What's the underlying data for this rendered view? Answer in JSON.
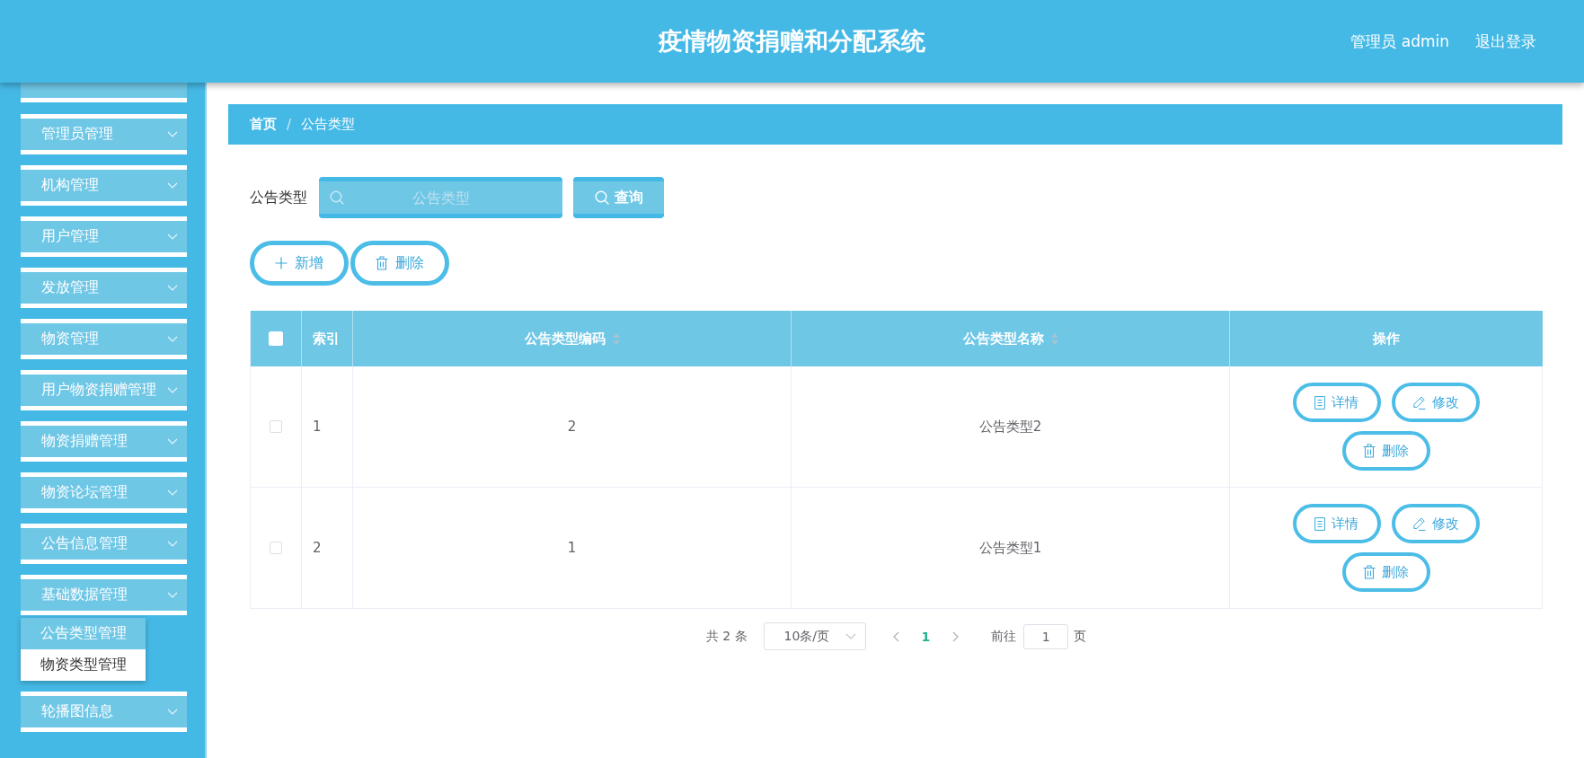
{
  "header": {
    "title": "疫情物资捐赠和分配系统",
    "user": "管理员 admin",
    "logout": "退出登录"
  },
  "sidebar": {
    "items": [
      {
        "label": "管理员管理"
      },
      {
        "label": "机构管理"
      },
      {
        "label": "用户管理"
      },
      {
        "label": "发放管理"
      },
      {
        "label": "物资管理"
      },
      {
        "label": "用户物资捐赠管理"
      },
      {
        "label": "物资捐赠管理"
      },
      {
        "label": "物资论坛管理"
      },
      {
        "label": "公告信息管理"
      },
      {
        "label": "基础数据管理",
        "children": [
          {
            "label": "公告类型管理",
            "selected": true
          },
          {
            "label": "物资类型管理",
            "selected": false
          }
        ]
      },
      {
        "label": "轮播图信息"
      }
    ]
  },
  "breadcrumb": {
    "items": [
      "首页",
      "公告类型"
    ],
    "separator": "/"
  },
  "search": {
    "label": "公告类型",
    "placeholder": "公告类型",
    "button": "查询"
  },
  "toolbar": [
    {
      "kind": "add",
      "label": "新增"
    },
    {
      "kind": "delete",
      "label": "删除"
    }
  ],
  "table": {
    "select_all": {
      "checked": false
    },
    "columns": [
      {
        "label": "索引",
        "sortable": false
      },
      {
        "label": "公告类型编码",
        "sortable": true
      },
      {
        "label": "公告类型名称",
        "sortable": true
      },
      {
        "label": "操作",
        "sortable": false
      }
    ],
    "rows": [
      {
        "checked": false,
        "cells": [
          "1",
          "2",
          "公告类型2"
        ],
        "actions": [
          {
            "kind": "detail",
            "label": "详情"
          },
          {
            "kind": "edit",
            "label": "修改"
          },
          {
            "kind": "delete",
            "label": "删除"
          }
        ]
      },
      {
        "checked": false,
        "cells": [
          "2",
          "1",
          "公告类型1"
        ],
        "actions": [
          {
            "kind": "detail",
            "label": "详情"
          },
          {
            "kind": "edit",
            "label": "修改"
          },
          {
            "kind": "delete",
            "label": "删除"
          }
        ]
      }
    ]
  },
  "pagination": {
    "total": "共 2 条",
    "page_size": "10条/页",
    "pages": [
      {
        "label": "1",
        "selected": true
      }
    ],
    "jump_label": "前往",
    "jump_value": "1",
    "jump_suffix": "页"
  }
}
